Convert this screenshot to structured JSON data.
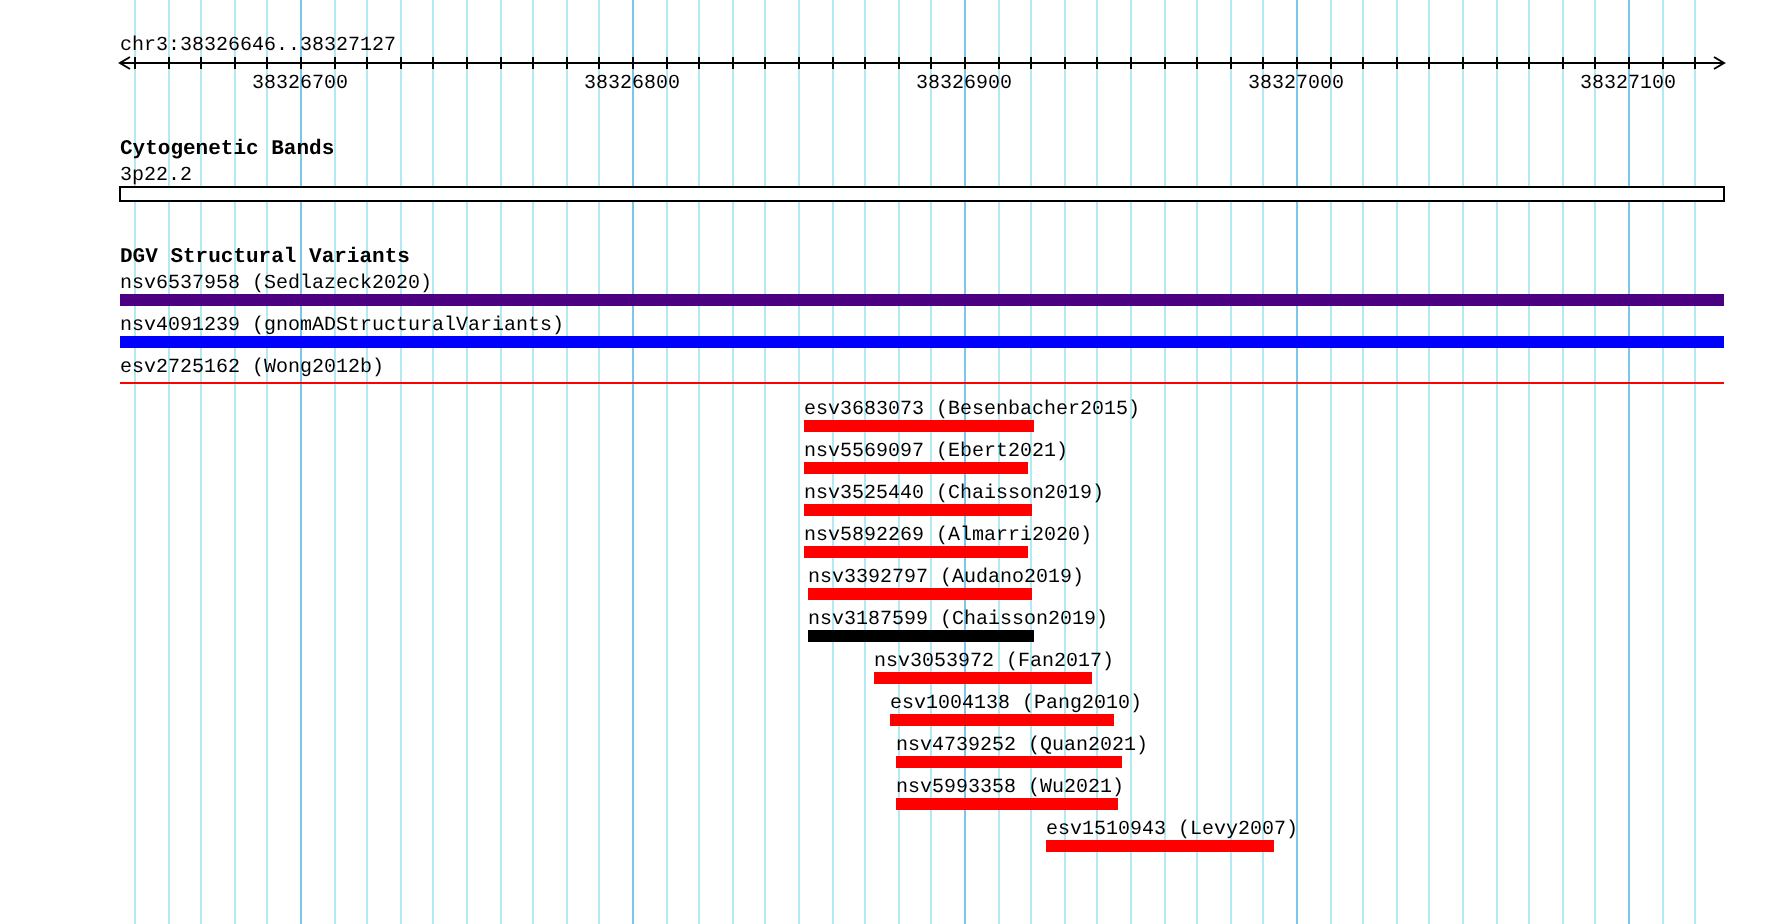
{
  "ruler": {
    "label": "chr3:38326646..38327127",
    "ticks": [
      "38326700",
      "38326800",
      "38326900",
      "38327000",
      "38327100"
    ]
  },
  "tracks": [
    {
      "title": "Cytogenetic Bands",
      "features": [
        {
          "label": "3p22.2",
          "kind": "band",
          "color": "#ffffff"
        }
      ]
    },
    {
      "title": "DGV Structural Variants",
      "features": [
        {
          "label": "nsv6537958 (Sedlazeck2020)",
          "kind": "bar",
          "color": "#4b0082"
        },
        {
          "label": "nsv4091239 (gnomADStructuralVariants)",
          "kind": "bar",
          "color": "#0000ff"
        },
        {
          "label": "esv2725162 (Wong2012b)",
          "kind": "line",
          "color": "#ff0000"
        },
        {
          "label": "esv3683073 (Besenbacher2015)",
          "kind": "bar",
          "color": "#ff0000"
        },
        {
          "label": "nsv5569097 (Ebert2021)",
          "kind": "bar",
          "color": "#ff0000"
        },
        {
          "label": "nsv3525440 (Chaisson2019)",
          "kind": "bar",
          "color": "#ff0000"
        },
        {
          "label": "nsv5892269 (Almarri2020)",
          "kind": "bar",
          "color": "#ff0000"
        },
        {
          "label": "nsv3392797 (Audano2019)",
          "kind": "bar",
          "color": "#ff0000"
        },
        {
          "label": "nsv3187599 (Chaisson2019)",
          "kind": "bar",
          "color": "#000000"
        },
        {
          "label": "nsv3053972 (Fan2017)",
          "kind": "bar",
          "color": "#ff0000"
        },
        {
          "label": "esv1004138 (Pang2010)",
          "kind": "bar",
          "color": "#ff0000"
        },
        {
          "label": "nsv4739252 (Quan2021)",
          "kind": "bar",
          "color": "#ff0000"
        },
        {
          "label": "nsv5993358 (Wu2021)",
          "kind": "bar",
          "color": "#ff0000"
        },
        {
          "label": "esv1510943 (Levy2007)",
          "kind": "bar",
          "color": "#ff0000"
        }
      ]
    }
  ]
}
